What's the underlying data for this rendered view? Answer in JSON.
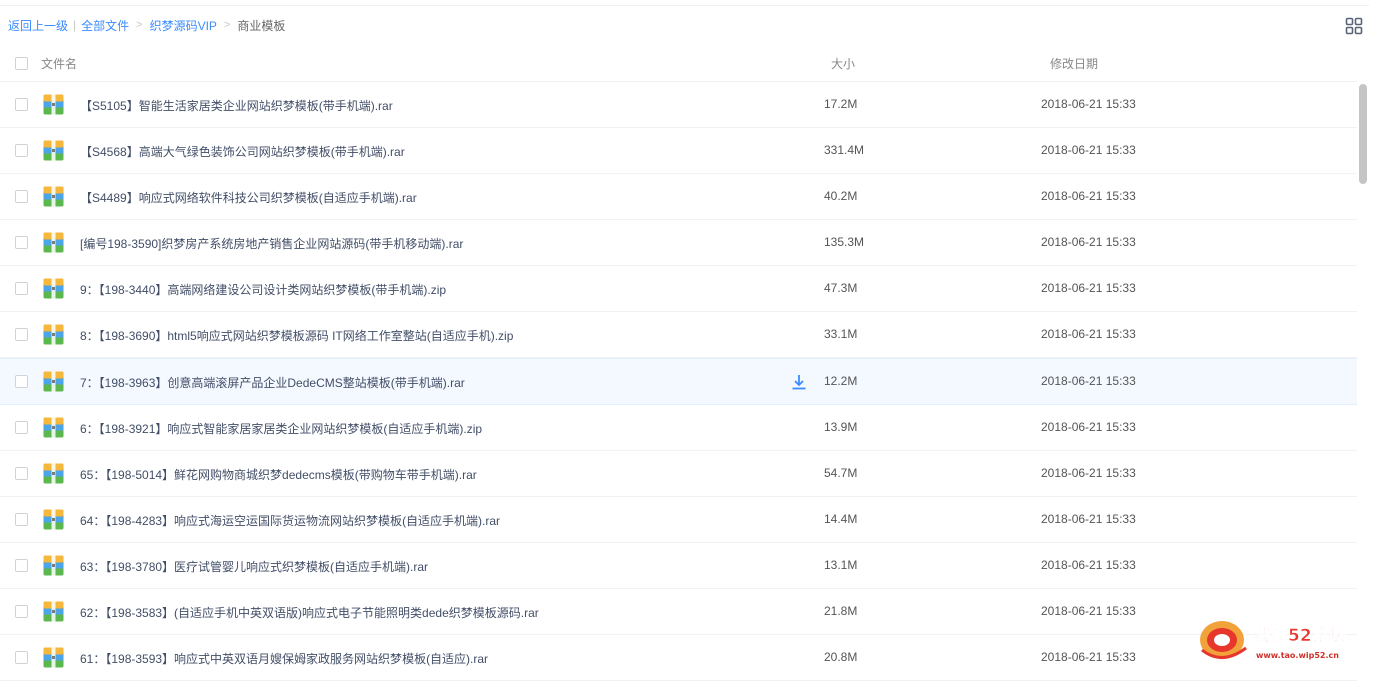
{
  "breadcrumb": {
    "back": "返回上一级",
    "sep": "|",
    "all": "全部文件",
    "arrow": ">",
    "folder": "织梦源码VIP",
    "current": "商业模板"
  },
  "header": {
    "name": "文件名",
    "size": "大小",
    "date": "修改日期"
  },
  "files": [
    {
      "name": "【S5105】智能生活家居类企业网站织梦模板(带手机端).rar",
      "size": "17.2M",
      "date": "2018-06-21 15:33"
    },
    {
      "name": "【S4568】高端大气绿色装饰公司网站织梦模板(带手机端).rar",
      "size": "331.4M",
      "date": "2018-06-21 15:33"
    },
    {
      "name": "【S4489】响应式网络软件科技公司织梦模板(自适应手机端).rar",
      "size": "40.2M",
      "date": "2018-06-21 15:33"
    },
    {
      "name": "[编号198-3590]织梦房产系统房地产销售企业网站源码(带手机移动端).rar",
      "size": "135.3M",
      "date": "2018-06-21 15:33"
    },
    {
      "name": "9：【198-3440】高端网络建设公司设计类网站织梦模板(带手机端).zip",
      "size": "47.3M",
      "date": "2018-06-21 15:33"
    },
    {
      "name": "8：【198-3690】html5响应式网站织梦模板源码 IT网络工作室整站(自适应手机).zip",
      "size": "33.1M",
      "date": "2018-06-21 15:33"
    },
    {
      "name": "7：【198-3963】创意高端滚屏产品企业DedeCMS整站模板(带手机端).rar",
      "size": "12.2M",
      "date": "2018-06-21 15:33"
    },
    {
      "name": "6：【198-3921】响应式智能家居家居类企业网站织梦模板(自适应手机端).zip",
      "size": "13.9M",
      "date": "2018-06-21 15:33"
    },
    {
      "name": "65：【198-5014】鲜花网购物商城织梦dedecms模板(带购物车带手机端).rar",
      "size": "54.7M",
      "date": "2018-06-21 15:33"
    },
    {
      "name": "64：【198-4283】响应式海运空运国际货运物流网站织梦模板(自适应手机端).rar",
      "size": "14.4M",
      "date": "2018-06-21 15:33"
    },
    {
      "name": "63：【198-3780】医疗试管婴儿响应式织梦模板(自适应手机端).rar",
      "size": "13.1M",
      "date": "2018-06-21 15:33"
    },
    {
      "name": "62：【198-3583】(自适应手机中英双语版)响应式电子节能照明类dede织梦模板源码.rar",
      "size": "21.8M",
      "date": "2018-06-21 15:33"
    },
    {
      "name": "61：【198-3593】响应式中英双语月嫂保姆家政服务网站织梦模板(自适应).rar",
      "size": "20.8M",
      "date": "2018-06-21 15:33"
    }
  ],
  "hover_row_index": 6,
  "icons": {
    "archive": "archive-file-icon",
    "download": "download-icon",
    "grid": "grid-view-icon"
  },
  "colors": {
    "link": "#3b8cff",
    "hover_row": "#f4f8ff",
    "download": "#3b8cff"
  },
  "watermark": {
    "text": "我爱52论坛",
    "url": "www.tao.wip52.cn"
  }
}
